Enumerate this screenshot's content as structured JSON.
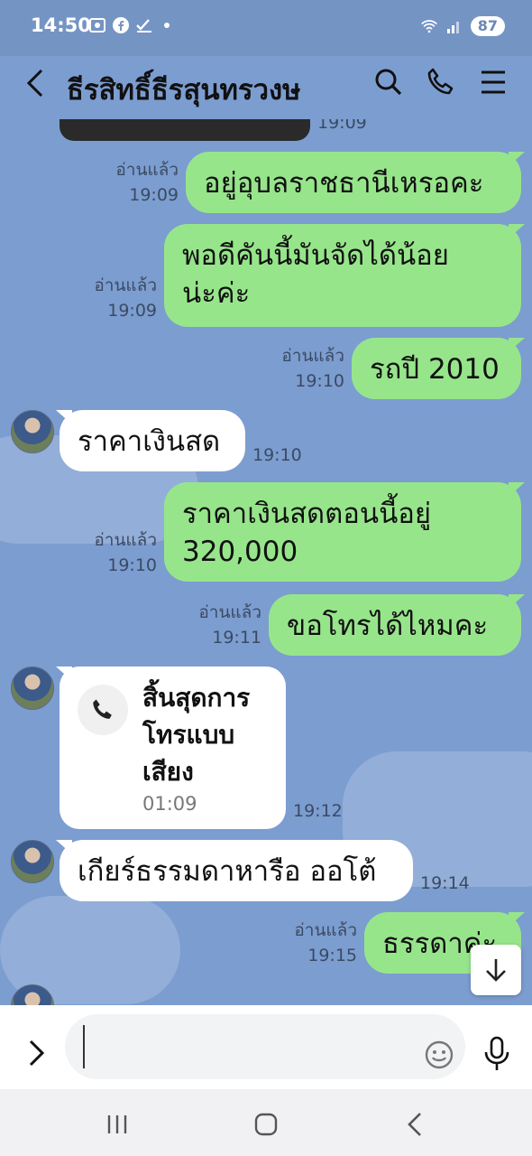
{
  "status_bar": {
    "time": "14:50",
    "battery": "87",
    "icons": [
      "screenshot-icon",
      "facebook-icon",
      "check-icon",
      "dot-icon",
      "wifi-icon",
      "signal-icon",
      "battery-icon"
    ]
  },
  "header": {
    "title": "ธีรสิทธิ์ธีรสุนทรวงษ",
    "icons": [
      "back-icon",
      "search-icon",
      "phone-icon",
      "menu-icon"
    ]
  },
  "messages": [
    {
      "id": "m0",
      "direction": "in",
      "type": "image",
      "time": "19:09"
    },
    {
      "id": "m1",
      "direction": "out",
      "text": "อยู่อุบลราชธานีเหรอคะ",
      "read": "อ่านแล้ว",
      "time": "19:09"
    },
    {
      "id": "m2",
      "direction": "out",
      "lines": [
        "พอดีคันนี้มันจัดได้น้อย",
        "น่ะค่ะ"
      ],
      "read": "อ่านแล้ว",
      "time": "19:09"
    },
    {
      "id": "m3",
      "direction": "out",
      "text": "รถปี 2010",
      "read": "อ่านแล้ว",
      "time": "19:10"
    },
    {
      "id": "m4",
      "direction": "in",
      "text": "ราคาเงินสด",
      "time": "19:10"
    },
    {
      "id": "m5",
      "direction": "out",
      "lines": [
        "ราคาเงินสดตอนนี้อยู่",
        "320,000"
      ],
      "read": "อ่านแล้ว",
      "time": "19:10"
    },
    {
      "id": "m6",
      "direction": "out",
      "text": "ขอโทรได้ไหมคะ",
      "read": "อ่านแล้ว",
      "time": "19:11"
    },
    {
      "id": "m7",
      "direction": "in",
      "type": "call",
      "lines": [
        "สิ้นสุดการ",
        "โทรแบบ",
        "เสียง"
      ],
      "duration": "01:09",
      "time": "19:12"
    },
    {
      "id": "m8",
      "direction": "in",
      "text": "เกียร์ธรรมดาหารือ ออโต้",
      "time": "19:14"
    },
    {
      "id": "m9",
      "direction": "out",
      "text": "ธรรดาค่ะ",
      "read": "อ่านแล้ว",
      "time": "19:15"
    }
  ],
  "input": {
    "value": "",
    "icons": [
      "chevron-right-icon",
      "emoji-icon",
      "mic-icon"
    ]
  },
  "colors": {
    "chat_background": "#7c9dd0",
    "outgoing_bubble": "#97e58b",
    "incoming_bubble": "#ffffff"
  }
}
